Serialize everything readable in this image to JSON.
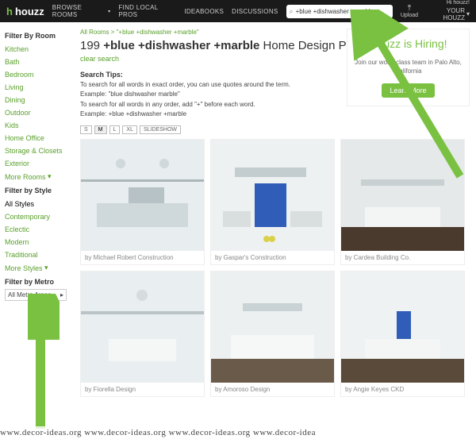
{
  "header": {
    "logo": "houzz",
    "nav": [
      {
        "label": "BROWSE ROOMS",
        "caret": true
      },
      {
        "label": "FIND LOCAL PROS",
        "caret": false
      },
      {
        "label": "IDEABOOKS",
        "caret": false
      },
      {
        "label": "DISCUSSIONS",
        "caret": false
      }
    ],
    "search_value": "+blue +dishwasher +marble",
    "upload_label": "Upload",
    "greeting": "Hi houzz!",
    "account_label": "YOUR HOUZZ"
  },
  "sidebar": {
    "room": {
      "title": "Filter By Room",
      "items": [
        "Kitchen",
        "Bath",
        "Bedroom",
        "Living",
        "Dining",
        "Outdoor",
        "Kids",
        "Home Office",
        "Storage & Closets",
        "Exterior"
      ],
      "more": "More Rooms"
    },
    "style": {
      "title": "Filter by Style",
      "items": [
        "All Styles",
        "Contemporary",
        "Eclectic",
        "Modern",
        "Traditional"
      ],
      "more": "More Styles"
    },
    "metro": {
      "title": "Filter by Metro",
      "select": "All Metro Areas"
    }
  },
  "main": {
    "breadcrumb_root": "All Rooms",
    "breadcrumb_query": "\"+blue +dishwasher +marble\"",
    "count": "199",
    "query_bold": "+blue +dishwasher +marble",
    "title_suffix": "Home Design Photos",
    "clear": "clear search",
    "tips_title": "Search Tips:",
    "tips_line1": "To search for all words in exact order, you can use quotes around the term.",
    "tips_ex1": "Example: \"blue dishwasher marble\"",
    "tips_line2": "To search for all words in any order, add \"+\" before each word.",
    "tips_ex2": "Example: +blue +dishwasher +marble",
    "view": {
      "s": "S",
      "m": "M",
      "l": "L",
      "xl": "XL",
      "slideshow": "SLIDESHOW"
    },
    "cards": [
      {
        "by": "Michael Robert Construction"
      },
      {
        "by": "Gaspar's Construction"
      },
      {
        "by": "Cardea Building Co."
      },
      {
        "by": "Fiorella Design"
      },
      {
        "by": "Amoroso Design"
      },
      {
        "by": "Angie Keyes CKD"
      }
    ]
  },
  "hiring": {
    "title": "Houzz is Hiring!",
    "body": "Join our world class team in Palo Alto, California",
    "cta": "Learn More"
  },
  "watermark": "www.decor-ideas.org www.decor-ideas.org www.decor-ideas.org www.decor-idea"
}
